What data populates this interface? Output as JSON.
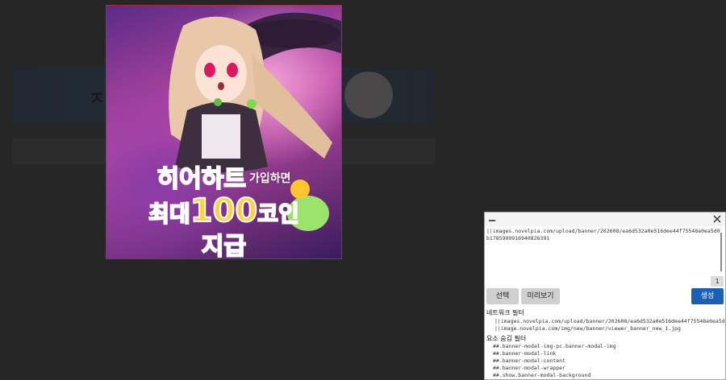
{
  "background": {
    "banner_text": "ㅈ"
  },
  "modal": {
    "line1_big": "히어하트",
    "line1_small": "가입하면",
    "line2_prefix": "최대",
    "line2_number": "100",
    "line2_suffix": "코인",
    "line3": "지급",
    "accent_color": "#ff3fa1"
  },
  "panel": {
    "filter_text": "||images.novelpia.com/upload/banner/202608/ea6d532a0e516dee44f75548e0ea5d0b1785999916940826391",
    "count": "1",
    "buttons": {
      "pick": "선택",
      "preview": "미리보기",
      "create": "생성"
    },
    "network_filter_title": "네트워크 필터",
    "network_rules": [
      "||images.novelpia.com/upload/banner/202608/ea6d532a0e516dee44f75548e0ea5d0b",
      "||image.novelpia.com/img/new/banner/viewer_banner_new_1.jpg"
    ],
    "hide_filter_title": "요소 숨김 필터",
    "hide_rules": [
      "##.banner-modal-img-pc.banner-modal-img",
      "##.banner-modal-link",
      "##.banner-modal-content",
      "##.banner-modal-wrapper",
      "##.show.banner-modal-background"
    ],
    "create_color": "#1a5fb4"
  }
}
